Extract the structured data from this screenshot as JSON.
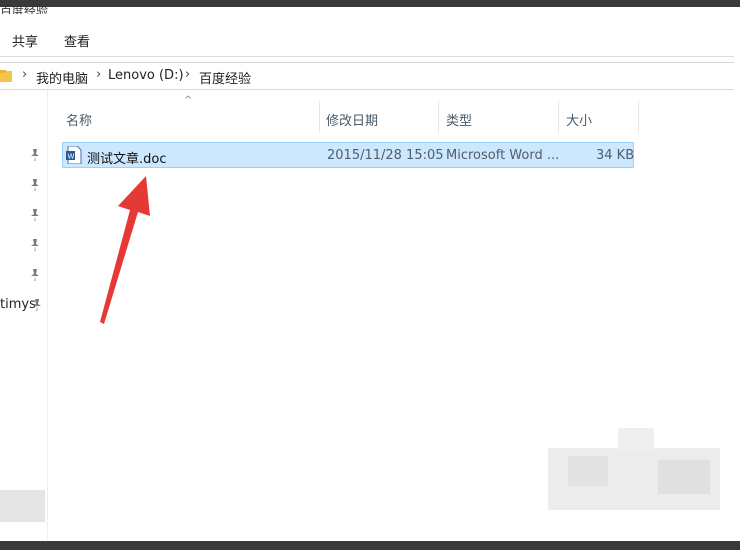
{
  "window": {
    "title_partial": "百度经验"
  },
  "ribbon": {
    "tabs": [
      {
        "label": "共享"
      },
      {
        "label": "查看"
      }
    ]
  },
  "address": {
    "segments": [
      "我的电脑",
      "Lenovo (D:)",
      "百度经验"
    ],
    "separator": "›"
  },
  "nav": {
    "partial_item": "timys"
  },
  "columns": {
    "name": "名称",
    "date": "修改日期",
    "type": "类型",
    "size": "大小",
    "sort_caret": "^"
  },
  "files": [
    {
      "name": "测试文章.doc",
      "modified": "2015/11/28 15:05",
      "type": "Microsoft Word ...",
      "size": "34 KB",
      "selected": true,
      "icon": "word-doc-icon"
    }
  ],
  "colors": {
    "selection_bg": "#cce8ff",
    "selection_border": "#99d1ff",
    "arrow": "#e53935",
    "folder": "#f4c542"
  }
}
